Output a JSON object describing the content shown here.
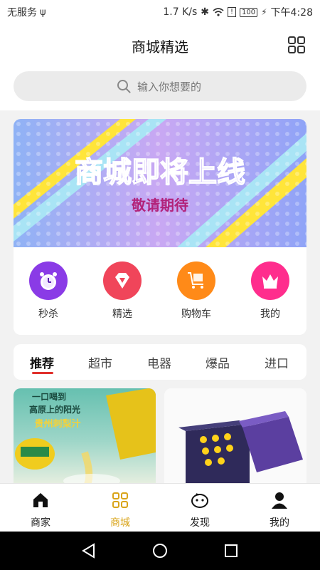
{
  "status_bar": {
    "carrier": "无服务",
    "speed": "1.7 K/s",
    "battery": "100",
    "time": "下午4:28"
  },
  "header": {
    "title": "商城精选"
  },
  "search": {
    "placeholder": "输入你想要的"
  },
  "banner": {
    "headline": "商城即将上线",
    "subline": "敬请期待"
  },
  "quick_actions": [
    {
      "label": "秒杀",
      "icon": "alarm-clock-icon",
      "color": "#8a3be6"
    },
    {
      "label": "精选",
      "icon": "diamond-icon",
      "color": "#f0455a"
    },
    {
      "label": "购物车",
      "icon": "cart-icon",
      "color": "#ff8a18"
    },
    {
      "label": "我的",
      "icon": "crown-icon",
      "color": "#ff2d8d"
    }
  ],
  "tabs": [
    "推荐",
    "超市",
    "电器",
    "爆品",
    "进口"
  ],
  "active_tab": "推荐",
  "products": [
    {
      "lines": [
        "一口喝到",
        "高原上的阳光",
        "贵州刺梨汁"
      ]
    },
    {
      "lines": []
    }
  ],
  "bottom_nav": [
    {
      "label": "商家",
      "icon": "home-icon",
      "active": false
    },
    {
      "label": "商城",
      "icon": "grid-icon",
      "active": true
    },
    {
      "label": "发现",
      "icon": "discover-icon",
      "active": false
    },
    {
      "label": "我的",
      "icon": "profile-icon",
      "active": false
    }
  ],
  "colors": {
    "accent": "#d9a419",
    "tab_underline": "#e0302c"
  }
}
